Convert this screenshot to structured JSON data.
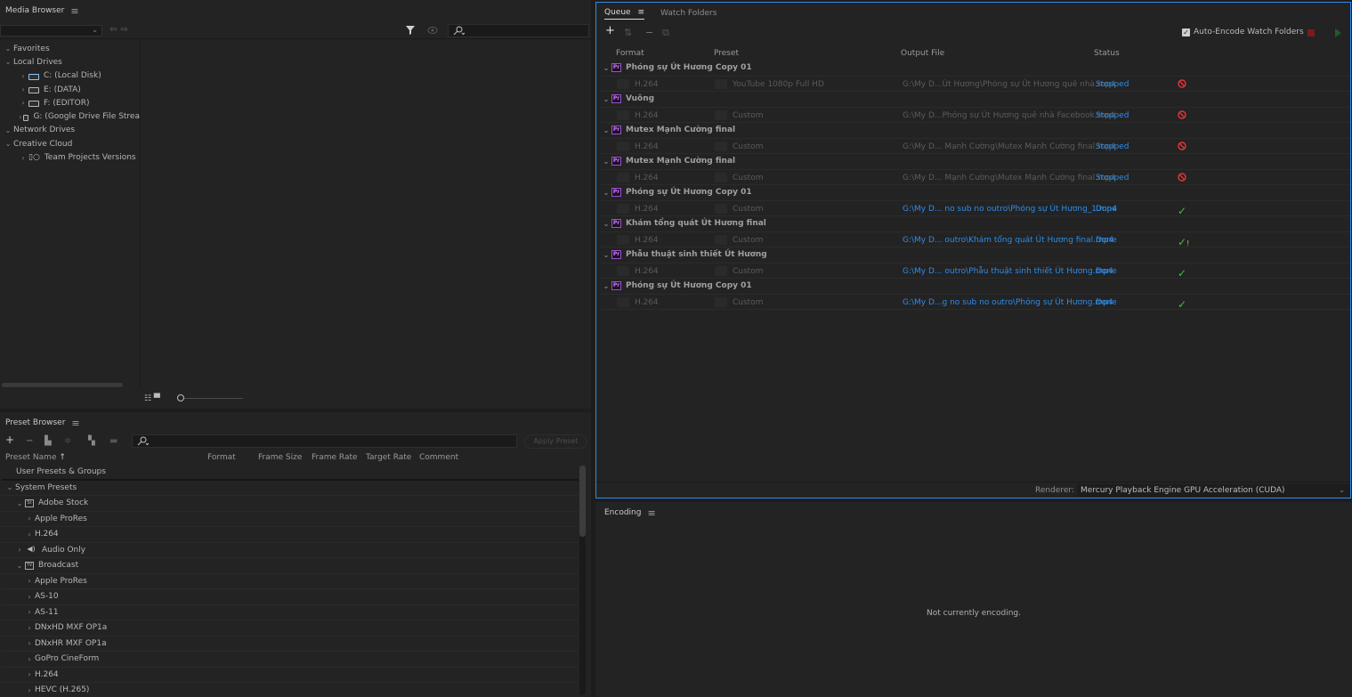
{
  "media_browser": {
    "title": "Media Browser",
    "menu_icon": "hamburger",
    "tree": [
      {
        "label": "Favorites",
        "level": 0,
        "expand": "v"
      },
      {
        "label": "Local Drives",
        "level": 0,
        "expand": "v"
      },
      {
        "label": "C: (Local Disk)",
        "level": 1,
        "expand": ">",
        "icon": "drive-c"
      },
      {
        "label": "E: (DATA)",
        "level": 1,
        "expand": ">",
        "icon": "drive"
      },
      {
        "label": "F: (EDITOR)",
        "level": 1,
        "expand": ">",
        "icon": "drive"
      },
      {
        "label": "G: (Google Drive File Strea",
        "level": 1,
        "expand": ">",
        "icon": "drive"
      },
      {
        "label": "Network Drives",
        "level": 0,
        "expand": "v"
      },
      {
        "label": "Creative Cloud",
        "level": 0,
        "expand": "v"
      },
      {
        "label": "Team Projects Versions",
        "level": 1,
        "expand": ">",
        "icon": "team-projects"
      }
    ]
  },
  "preset_browser": {
    "title": "Preset Browser",
    "apply_preset_label": "Apply Preset",
    "columns": {
      "name": "Preset Name",
      "format": "Format",
      "frame_size": "Frame Size",
      "frame_rate": "Frame Rate",
      "target_rate": "Target Rate",
      "comment": "Comment"
    },
    "rows": [
      {
        "label": "User Presets & Groups",
        "level": 0,
        "expand": "",
        "icon": ""
      },
      {
        "label": "System Presets",
        "level": 0,
        "expand": "v",
        "icon": ""
      },
      {
        "label": "Adobe Stock",
        "level": 1,
        "expand": "v",
        "icon": "St"
      },
      {
        "label": "Apple ProRes",
        "level": 2,
        "expand": ">",
        "icon": ""
      },
      {
        "label": "H.264",
        "level": 2,
        "expand": ">",
        "icon": ""
      },
      {
        "label": "Audio Only",
        "level": 1,
        "expand": ">",
        "icon": "speaker"
      },
      {
        "label": "Broadcast",
        "level": 1,
        "expand": "v",
        "icon": "TV"
      },
      {
        "label": "Apple ProRes",
        "level": 2,
        "expand": ">",
        "icon": ""
      },
      {
        "label": "AS-10",
        "level": 2,
        "expand": ">",
        "icon": ""
      },
      {
        "label": "AS-11",
        "level": 2,
        "expand": ">",
        "icon": ""
      },
      {
        "label": "DNxHD MXF OP1a",
        "level": 2,
        "expand": ">",
        "icon": ""
      },
      {
        "label": "DNxHR MXF OP1a",
        "level": 2,
        "expand": ">",
        "icon": ""
      },
      {
        "label": "GoPro CineForm",
        "level": 2,
        "expand": ">",
        "icon": ""
      },
      {
        "label": "H.264",
        "level": 2,
        "expand": ">",
        "icon": ""
      },
      {
        "label": "HEVC (H.265)",
        "level": 2,
        "expand": ">",
        "icon": ""
      }
    ]
  },
  "queue": {
    "tabs": [
      "Queue",
      "Watch Folders"
    ],
    "auto_encode_label": "Auto-Encode Watch Folders",
    "auto_encode_checked": true,
    "columns": {
      "format": "Format",
      "preset": "Preset",
      "output": "Output File",
      "status": "Status"
    },
    "items": [
      {
        "source": "Phóng sự Út Hương Copy 01",
        "format": "H.264",
        "preset": "YouTube 1080p Full HD",
        "output": "G:\\My D...Út Hương\\Phóng sự Út Hương quê nhà.mp4",
        "status": "Stopped",
        "state": "stopped"
      },
      {
        "source": "Vuông",
        "format": "H.264",
        "preset": "Custom",
        "output": "G:\\My D...Phóng sự Út Hương quê nhà Facebook.mp4",
        "status": "Stopped",
        "state": "stopped"
      },
      {
        "source": "Mutex Mạnh Cường final",
        "format": "H.264",
        "preset": "Custom",
        "output": "G:\\My D... Mạnh Cường\\Mutex Mạnh Cường final.mp4",
        "status": "Stopped",
        "state": "stopped"
      },
      {
        "source": "Mutex Mạnh Cường final",
        "format": "H.264",
        "preset": "Custom",
        "output": "G:\\My D... Mạnh Cường\\Mutex Mạnh Cường final.mp4",
        "status": "Stopped",
        "state": "stopped"
      },
      {
        "source": "Phóng sự Út Hương Copy 01",
        "format": "H.264",
        "preset": "Custom",
        "output": "G:\\My D... no sub no outro\\Phóng sự Út Hương_1.mp4",
        "status": "Done",
        "state": "done"
      },
      {
        "source": "Khám tổng quát Út Hương final",
        "format": "H.264",
        "preset": "Custom",
        "output": "G:\\My D... outro\\Khám tổng quát Út Hương final.mp4",
        "status": "Done",
        "state": "done-warning"
      },
      {
        "source": "Phẫu thuật sinh thiết Út Hương",
        "format": "H.264",
        "preset": "Custom",
        "output": "G:\\My D... outro\\Phẫu thuật sinh thiết Út Hương.mp4",
        "status": "Done",
        "state": "done"
      },
      {
        "source": "Phóng sự Út Hương Copy 01",
        "format": "H.264",
        "preset": "Custom",
        "output": "G:\\My D...g no sub no outro\\Phóng sự Út Hương.mp4",
        "status": "Done",
        "state": "done"
      }
    ],
    "renderer_label": "Renderer:",
    "renderer_value": "Mercury Playback Engine GPU Acceleration (CUDA)"
  },
  "encoding": {
    "title": "Encoding",
    "message": "Not currently encoding."
  },
  "colors": {
    "accent": "#2d8ceb",
    "done_check": "#3fbf3f",
    "stopped_icon": "#e0363c",
    "premiere_badge": "#9b4fcf"
  }
}
